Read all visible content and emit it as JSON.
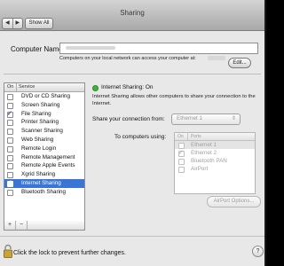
{
  "window": {
    "title": "Sharing",
    "nav_back": "◀",
    "nav_forward": "▶",
    "show_all_label": "Show All"
  },
  "computer_name": {
    "label": "Computer Name:",
    "value": "",
    "description": "Computers on your local network can access your computer at:",
    "edit_label": "Edit..."
  },
  "services": {
    "header_on": "On",
    "header_service": "Service",
    "items": [
      {
        "label": "DVD or CD Sharing",
        "checked": false,
        "selected": false
      },
      {
        "label": "Screen Sharing",
        "checked": false,
        "selected": false
      },
      {
        "label": "File Sharing",
        "checked": true,
        "selected": false
      },
      {
        "label": "Printer Sharing",
        "checked": false,
        "selected": false
      },
      {
        "label": "Scanner Sharing",
        "checked": false,
        "selected": false
      },
      {
        "label": "Web Sharing",
        "checked": false,
        "selected": false
      },
      {
        "label": "Remote Login",
        "checked": false,
        "selected": false
      },
      {
        "label": "Remote Management",
        "checked": false,
        "selected": false
      },
      {
        "label": "Remote Apple Events",
        "checked": false,
        "selected": false
      },
      {
        "label": "Xgrid Sharing",
        "checked": false,
        "selected": false
      },
      {
        "label": "Internet Sharing",
        "checked": true,
        "selected": true
      },
      {
        "label": "Bluetooth Sharing",
        "checked": false,
        "selected": false
      }
    ],
    "add_label": "+",
    "remove_label": "−"
  },
  "detail": {
    "status": "Internet Sharing: On",
    "status_color": "#3bb53a",
    "description": "Internet Sharing allows other computers to share your connection to the Internet.",
    "share_from_label": "Share your connection from:",
    "share_from_value": "Ethernet 1",
    "to_computers_label": "To computers using:",
    "ports_header_on": "On",
    "ports_header_ports": "Ports",
    "ports": [
      {
        "label": "Ethernet 1",
        "checked": false,
        "selected": true
      },
      {
        "label": "Ethernet 2",
        "checked": true,
        "selected": false
      },
      {
        "label": "Bluetooth PAN",
        "checked": false,
        "selected": false
      },
      {
        "label": "AirPort",
        "checked": false,
        "selected": false
      }
    ],
    "airport_options_label": "AirPort Options..."
  },
  "footer": {
    "lock_text": "Click the lock to prevent further changes.",
    "help_label": "?"
  },
  "colors": {
    "selection": "#3875d7",
    "window_bg": "#e8e8e8"
  }
}
